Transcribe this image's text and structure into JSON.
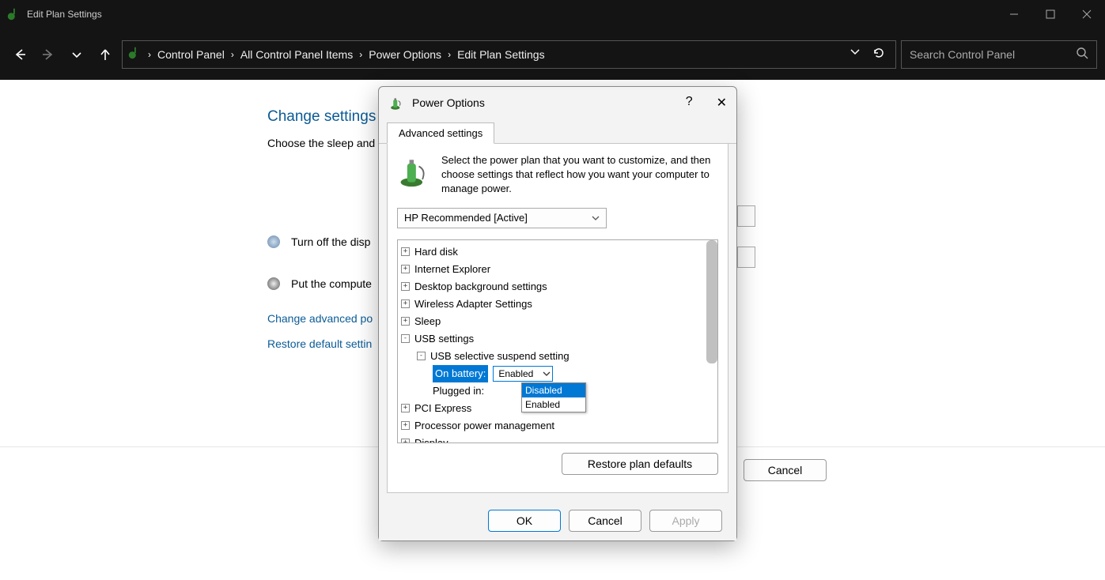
{
  "window": {
    "title": "Edit Plan Settings"
  },
  "breadcrumb": {
    "items": [
      "Control Panel",
      "All Control Panel Items",
      "Power Options",
      "Edit Plan Settings"
    ]
  },
  "search": {
    "placeholder": "Search Control Panel"
  },
  "page": {
    "heading": "Change settings",
    "sub": "Choose the sleep and",
    "row1": "Turn off the disp",
    "row2": "Put the compute",
    "link1": "Change advanced po",
    "link2": "Restore default settin",
    "save_label": "",
    "cancel_label": "Cancel"
  },
  "dialog": {
    "title": "Power Options",
    "tab": "Advanced settings",
    "description": "Select the power plan that you want to customize, and then choose settings that reflect how you want your computer to manage power.",
    "plan": "HP Recommended [Active]",
    "tree": {
      "n0": "Hard disk",
      "n1": "Internet Explorer",
      "n2": "Desktop background settings",
      "n3": "Wireless Adapter Settings",
      "n4": "Sleep",
      "n5": "USB settings",
      "n5a": "USB selective suspend setting",
      "on_battery_label": "On battery:",
      "on_battery_value": "Enabled",
      "plugged_in_label": "Plugged in:",
      "n6": "PCI Express",
      "n7": "Processor power management",
      "n8": "Display",
      "options": [
        "Disabled",
        "Enabled"
      ]
    },
    "restore": "Restore plan defaults",
    "ok": "OK",
    "cancel": "Cancel",
    "apply": "Apply"
  }
}
